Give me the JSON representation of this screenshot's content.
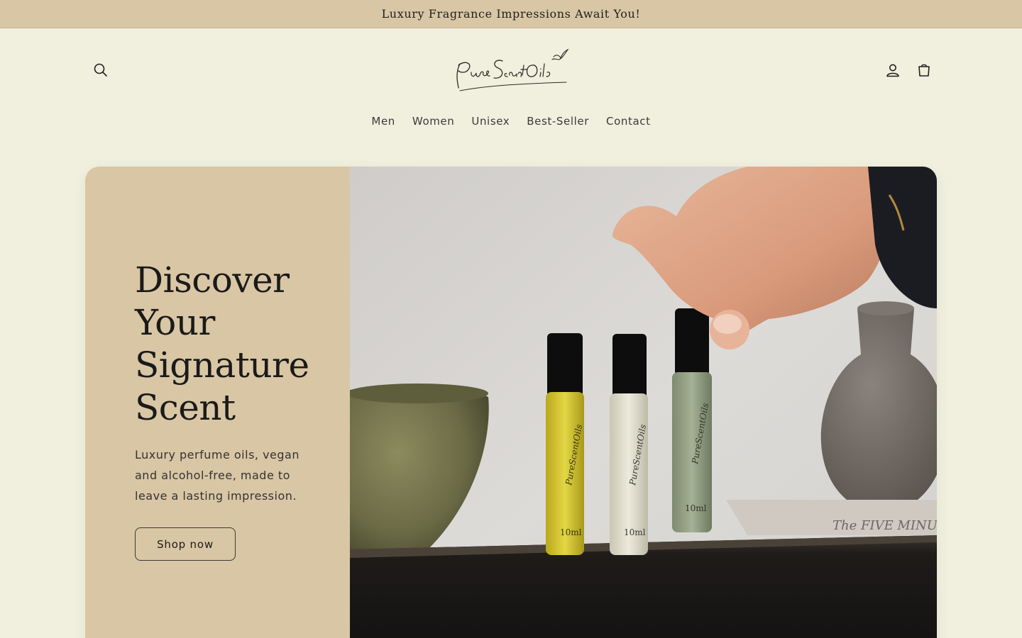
{
  "announcement": {
    "text": "Luxury Fragrance Impressions Await You!"
  },
  "header": {
    "logo_text": "PureScentOils",
    "icons": {
      "search": "search-icon",
      "account": "account-icon",
      "cart": "cart-icon"
    }
  },
  "nav": {
    "items": [
      {
        "label": "Men"
      },
      {
        "label": "Women"
      },
      {
        "label": "Unisex"
      },
      {
        "label": "Best-Seller"
      },
      {
        "label": "Contact"
      }
    ]
  },
  "hero": {
    "title_lines": [
      "Discover",
      "Your",
      "Signature",
      "Scent"
    ],
    "subtitle": "Luxury perfume oils, vegan and alcohol-free, made to leave a lasting impression.",
    "cta": "Shop now",
    "bottles": [
      {
        "volume": "10ml",
        "brand": "PureScentOils"
      },
      {
        "volume": "10ml",
        "brand": "PureScentOils"
      },
      {
        "volume": "10ml",
        "brand": "PureScentOils"
      }
    ],
    "book_text": "The FIVE MINUT"
  },
  "colors": {
    "background": "#f1efdd",
    "accent": "#d9c6a4",
    "text": "#1a1a1a"
  }
}
